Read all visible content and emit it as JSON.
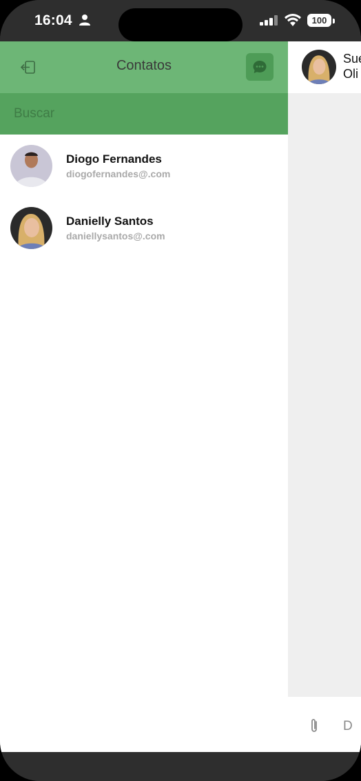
{
  "status_bar": {
    "time": "16:04",
    "battery": "100"
  },
  "contacts_panel": {
    "title": "Contatos",
    "search_placeholder": "Buscar",
    "contacts": [
      {
        "name": "Diogo Fernandes",
        "email": "diogofernandes@.com"
      },
      {
        "name": "Danielly Santos",
        "email": "daniellysantos@.com"
      }
    ]
  },
  "chat_panel": {
    "contact_name": "Sue\nOli",
    "composer_placeholder": "D"
  },
  "colors": {
    "header_green": "#6db676",
    "search_green": "#55a35e",
    "button_green": "#4e9c57"
  }
}
